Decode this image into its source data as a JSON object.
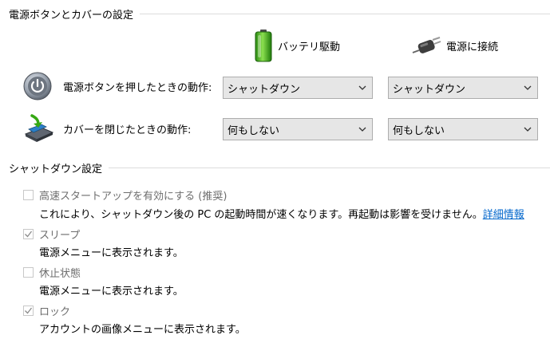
{
  "power_section": {
    "title": "電源ボタンとカバーの設定",
    "columns": {
      "battery": "バッテリ駆動",
      "plugged": "電源に接続"
    },
    "rows": [
      {
        "label": "電源ボタンを押したときの動作:",
        "battery_value": "シャットダウン",
        "plugged_value": "シャットダウン"
      },
      {
        "label": "カバーを閉じたときの動作:",
        "battery_value": "何もしない",
        "plugged_value": "何もしない"
      }
    ]
  },
  "shutdown_section": {
    "title": "シャットダウン設定",
    "options": [
      {
        "label": "高速スタートアップを有効にする (推奨)",
        "checked": false,
        "description": "これにより、シャットダウン後の PC の起動時間が速くなります。再起動は影響を受けません。",
        "link": "詳細情報"
      },
      {
        "label": "スリープ",
        "checked": true,
        "description": "電源メニューに表示されます。"
      },
      {
        "label": "休止状態",
        "checked": false,
        "description": "電源メニューに表示されます。"
      },
      {
        "label": "ロック",
        "checked": true,
        "description": "アカウントの画像メニューに表示されます。"
      }
    ]
  },
  "icons": {
    "battery": "battery-icon",
    "plug": "power-plug-icon",
    "power_button": "power-button-icon",
    "lid": "laptop-lid-icon",
    "chevron": "chevron-down-icon",
    "check": "checkmark-icon"
  }
}
